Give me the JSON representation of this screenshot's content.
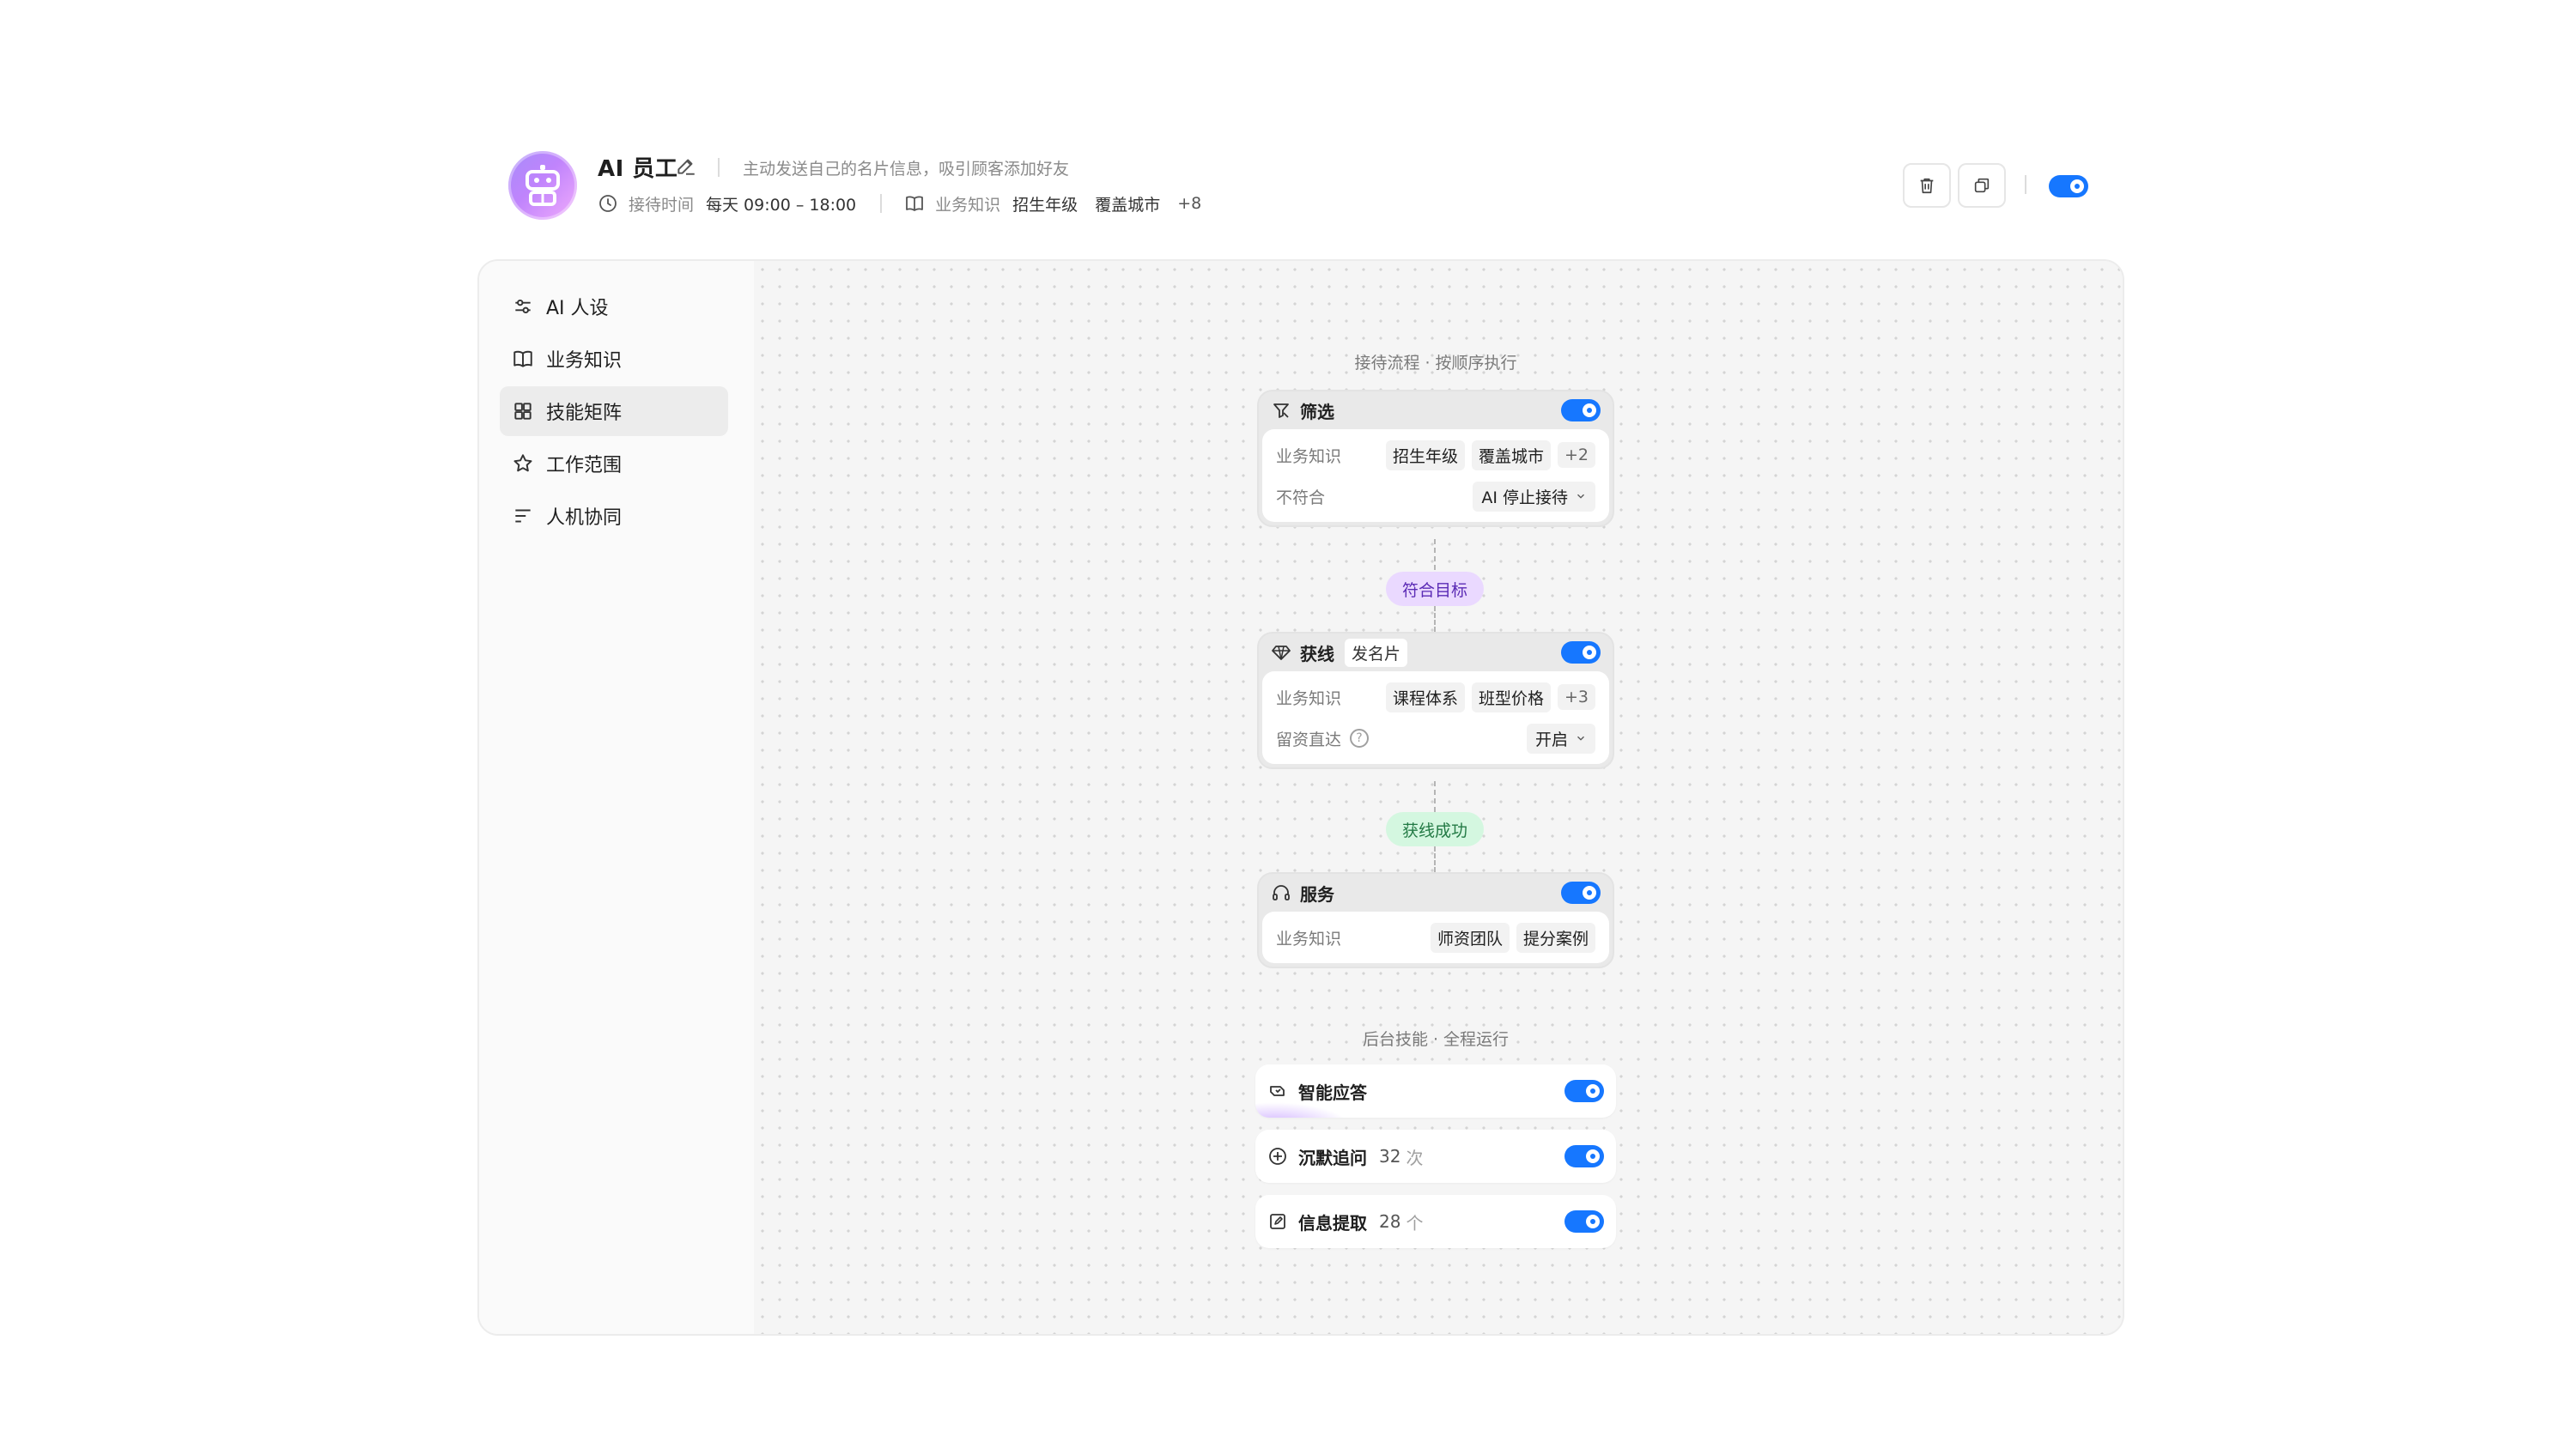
{
  "header": {
    "title": "AI 员工",
    "description": "主动发送自己的名片信息，吸引顾客添加好友",
    "reception_label": "接待时间",
    "reception_value": "每天 09:00 – 18:00",
    "knowledge_label": "业务知识",
    "knowledge_tags": [
      "招生年级",
      "覆盖城市"
    ],
    "knowledge_more": "+8",
    "accent_color": "#1677ff"
  },
  "sidebar": {
    "items": [
      {
        "label": "AI 人设",
        "icon": "sliders-icon"
      },
      {
        "label": "业务知识",
        "icon": "book-icon"
      },
      {
        "label": "技能矩阵",
        "icon": "grid-icon",
        "active": true
      },
      {
        "label": "工作范围",
        "icon": "star-icon"
      },
      {
        "label": "人机协同",
        "icon": "lines-icon"
      }
    ]
  },
  "flow": {
    "title": "接待流程 · 按顺序执行",
    "filter": {
      "name": "筛选",
      "knowledge_label": "业务知识",
      "tags": [
        "招生年级",
        "覆盖城市"
      ],
      "more": "+2",
      "mismatch_label": "不符合",
      "mismatch_value": "AI 停止接待"
    },
    "connector1": "符合目标",
    "lead": {
      "name": "获线",
      "chip": "发名片",
      "knowledge_label": "业务知识",
      "tags": [
        "课程体系",
        "班型价格"
      ],
      "more": "+3",
      "direct_label": "留资直达",
      "direct_value": "开启"
    },
    "connector2": "获线成功",
    "service": {
      "name": "服务",
      "knowledge_label": "业务知识",
      "tags": [
        "师资团队",
        "提分案例"
      ]
    }
  },
  "background": {
    "title": "后台技能 · 全程运行",
    "items": [
      {
        "name": "智能应答",
        "count": "",
        "unit": ""
      },
      {
        "name": "沉默追问",
        "count": "32",
        "unit": "次"
      },
      {
        "name": "信息提取",
        "count": "28",
        "unit": "个"
      }
    ]
  }
}
